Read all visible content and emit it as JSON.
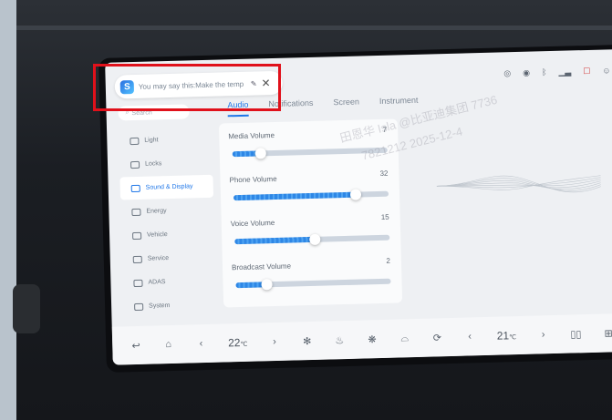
{
  "voice": {
    "logo": "S",
    "utterance": "You may say this:Make the temp",
    "glyph": "✎",
    "close": "✕"
  },
  "status_icons": [
    "broadcast-icon",
    "wifi-icon",
    "bluetooth-icon",
    "signal-icon",
    "phone-icon",
    "user-icon"
  ],
  "search": {
    "placeholder": "Search"
  },
  "tabs": [
    {
      "label": "Audio",
      "active": true
    },
    {
      "label": "Notifications",
      "active": false
    },
    {
      "label": "Screen",
      "active": false
    },
    {
      "label": "Instrument",
      "active": false
    }
  ],
  "sidebar": {
    "items": [
      {
        "label": "Light",
        "active": false
      },
      {
        "label": "Locks",
        "active": false
      },
      {
        "label": "Sound & Display",
        "active": true
      },
      {
        "label": "Energy",
        "active": false
      },
      {
        "label": "Vehicle",
        "active": false
      },
      {
        "label": "Service",
        "active": false
      },
      {
        "label": "ADAS",
        "active": false
      },
      {
        "label": "System",
        "active": false
      }
    ]
  },
  "volumes": [
    {
      "label": "Media Volume",
      "value": "7",
      "level": 0.18
    },
    {
      "label": "Phone Volume",
      "value": "32",
      "level": 0.79
    },
    {
      "label": "Voice Volume",
      "value": "15",
      "level": 0.52
    },
    {
      "label": "Broadcast Volume",
      "value": "2",
      "level": 0.2
    }
  ],
  "dock": {
    "back": "↩",
    "home": "⌂",
    "temp_left": "22",
    "temp_right": "21",
    "temp_unit": "℃",
    "prev": "‹",
    "next": "›",
    "recent": "▯▯",
    "grid": "⊞"
  },
  "watermark": {
    "line1": "田恩华 Isla @比亚迪集团 7736",
    "line2": "7821212 2025-12-4"
  },
  "colors": {
    "accent": "#1e76e8",
    "highlight": "#e0111b"
  }
}
